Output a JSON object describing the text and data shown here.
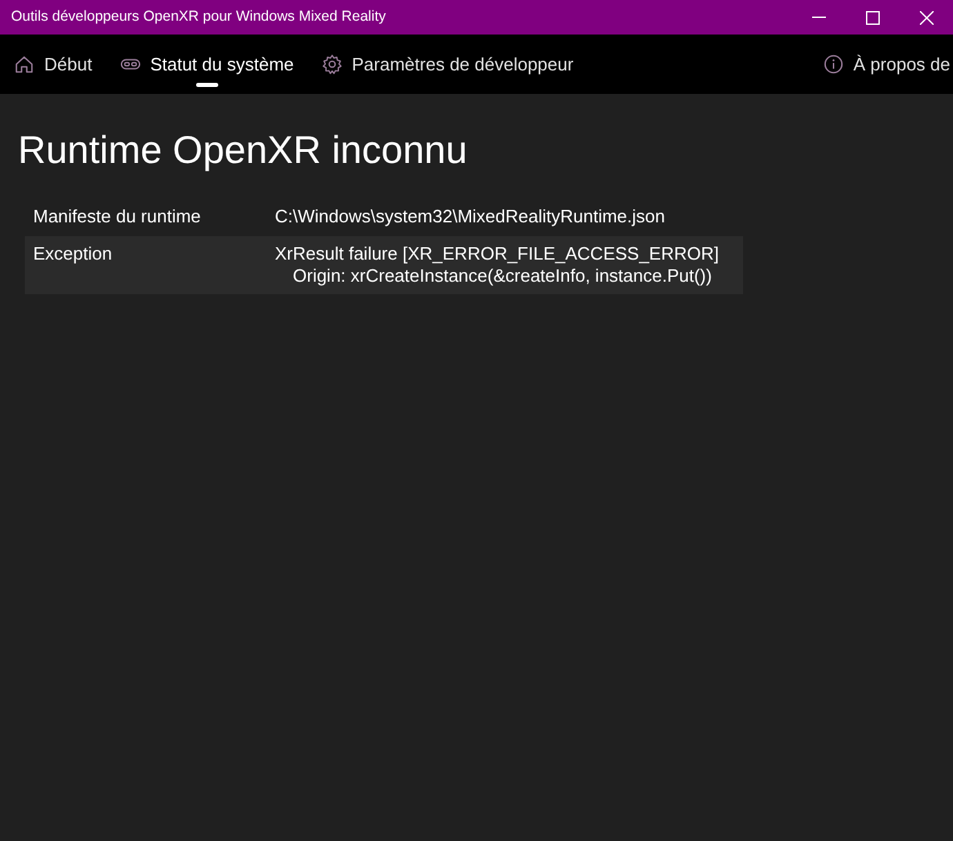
{
  "window": {
    "title": "Outils développeurs OpenXR pour Windows Mixed Reality"
  },
  "nav": {
    "tabs": [
      {
        "label": "Début",
        "selected": false
      },
      {
        "label": "Statut du système",
        "selected": true
      },
      {
        "label": "Paramètres de développeur",
        "selected": false
      }
    ],
    "about_tab": {
      "label": "À propos de",
      "selected": false
    }
  },
  "heading": "Runtime OpenXR inconnu",
  "details": [
    {
      "label": "Manifeste du runtime",
      "value": "C:\\Windows\\system32\\MixedRealityRuntime.json"
    },
    {
      "label": "Exception",
      "value": "XrResult failure [XR_ERROR_FILE_ACCESS_ERROR]\nOrigin: xrCreateInstance(&createInfo, instance.Put())"
    }
  ]
}
